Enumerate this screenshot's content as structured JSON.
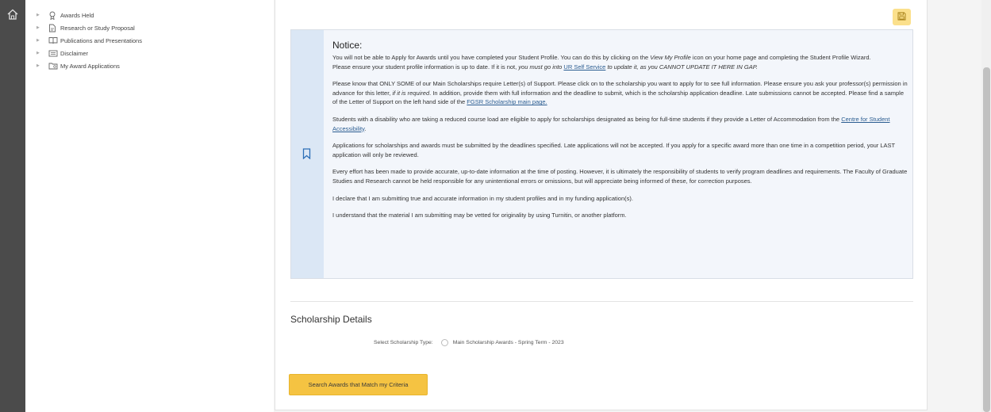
{
  "nav": {
    "items": [
      {
        "label": "Awards Held",
        "icon": "award-ribbon-icon"
      },
      {
        "label": "Research or Study Proposal",
        "icon": "document-icon"
      },
      {
        "label": "Publications and Presentations",
        "icon": "open-book-icon"
      },
      {
        "label": "Disclaimer",
        "icon": "disclaimer-icon"
      },
      {
        "label": "My Award Applications",
        "icon": "folder-award-icon"
      }
    ]
  },
  "notice": {
    "title": "Notice:",
    "p1": {
      "a": "You will not be able to Apply for Awards until you have completed your Student Profile. You can do this by clicking on the ",
      "em1": "View My Profile",
      "b": " icon on your home page and completing the Student Profile Wizard.",
      "c": "Please ensure your student profile information is up to date. If it is not, ",
      "em2": "you must go into ",
      "link": "UR Self Service",
      "em3": " to update it, as you CANNOT UPDATE IT HERE IN GAP."
    },
    "p2": {
      "a": "Please know that ONLY SOME of our Main Scholarships require Letter(s) of Support. Please click on to the scholarship you want to apply for to see full information. Please ensure you ask your professor(s) permission in advance for this letter, ",
      "em": "if it is required",
      "b": ". In addition, provide them with full information and the deadline to submit, which is the scholarship application deadline. Late submissions cannot be accepted. Please find a sample of the Letter of Support on the left hand side of the ",
      "link": "FGSR Scholarship main page."
    },
    "p3": {
      "a": "Students with a disability who are taking a reduced course load are eligible to apply for scholarships designated as being for full-time students if they provide a Letter of Accommodation from the ",
      "link": "Centre for Student Accessibility",
      "b": "."
    },
    "p4": "Applications for scholarships and awards must be submitted by the deadlines specified. Late applications will not be accepted. If you apply for a specific award more than one time in a competition period, your LAST application will only be reviewed.",
    "p5": "Every effort has been made to provide accurate, up-to-date information at the time of posting. However, it is ultimately the responsibility of students to verify program deadlines and requirements. The Faculty of Graduate Studies and Research cannot be held responsible for any unintentional errors or omissions, but will appreciate being informed of these, for correction purposes.",
    "p6": "I declare that I am submitting true and accurate information in my student profiles and in my funding application(s).",
    "p7": "I understand that the material I am submitting may be vetted for originality by using Turnitin, or another platform."
  },
  "scholarship": {
    "section_title": "Scholarship Details",
    "select_label": "Select Scholarship Type:",
    "option_label": "Main Scholarship Awards - Spring Term - 2023",
    "search_button": "Search Awards that Match my Criteria"
  },
  "colors": {
    "accent_yellow": "#f5c342",
    "notice_strip": "#dbe7f5",
    "link_blue": "#2b5d91",
    "left_rail": "#4b4b4b"
  }
}
